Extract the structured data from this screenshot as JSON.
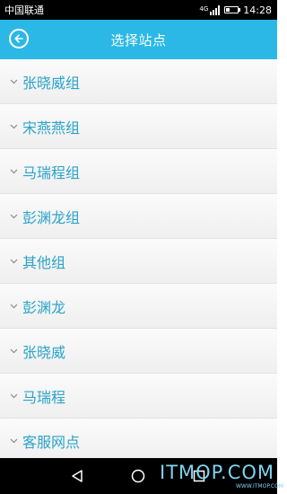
{
  "status_bar": {
    "carrier": "中国联通",
    "network": "4G",
    "time": "14:28"
  },
  "header": {
    "title": "选择站点",
    "back_icon": "back-arrow-circle-icon"
  },
  "station_list": [
    {
      "label": "张晓威组"
    },
    {
      "label": "宋燕燕组"
    },
    {
      "label": "马瑞程组"
    },
    {
      "label": "彭渊龙组"
    },
    {
      "label": "其他组"
    },
    {
      "label": "彭渊龙"
    },
    {
      "label": "张晓威"
    },
    {
      "label": "马瑞程"
    },
    {
      "label": "客服网点"
    }
  ],
  "watermark": {
    "text": "ITMOP.COM",
    "sub": "WWW.ITMOP.COM"
  },
  "colors": {
    "header": "#2bb8e6",
    "label": "#2aa3c9"
  }
}
